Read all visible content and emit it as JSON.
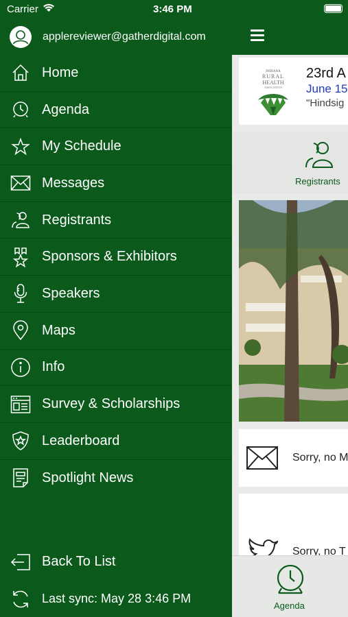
{
  "status": {
    "carrier": "Carrier",
    "time": "3:46 PM"
  },
  "user": {
    "email": "applereviewer@gatherdigital.com"
  },
  "menu": [
    {
      "label": "Home",
      "icon": "home-icon"
    },
    {
      "label": "Agenda",
      "icon": "clock-icon"
    },
    {
      "label": "My Schedule",
      "icon": "star-icon"
    },
    {
      "label": "Messages",
      "icon": "envelope-icon"
    },
    {
      "label": "Registrants",
      "icon": "people-icon"
    },
    {
      "label": "Sponsors & Exhibitors",
      "icon": "ribbon-star-icon"
    },
    {
      "label": "Speakers",
      "icon": "microphone-icon"
    },
    {
      "label": "Maps",
      "icon": "map-pin-icon"
    },
    {
      "label": "Info",
      "icon": "info-icon"
    },
    {
      "label": "Survey &  Scholarships",
      "icon": "survey-icon"
    },
    {
      "label": "Leaderboard",
      "icon": "shield-star-icon"
    },
    {
      "label": "Spotlight News",
      "icon": "news-icon"
    }
  ],
  "bottom_menu": {
    "back_label": "Back To List",
    "sync_label": "Last sync:  May 28 3:46 PM"
  },
  "event": {
    "title": "23rd A",
    "date": "June 15",
    "theme": "\"Hindsig",
    "logo_text": [
      "INDIANA",
      "RURAL",
      "HEALTH",
      "ASSOCIATION"
    ]
  },
  "tiles": {
    "registrants_label": "Registrants"
  },
  "messages_card": {
    "text": "Sorry, no M"
  },
  "twitter_card": {
    "text": "Sorry, no T"
  },
  "tabbar": {
    "agenda_label": "Agenda"
  },
  "colors": {
    "brand_green": "#0b5a1b",
    "date_blue": "#1f3cba"
  }
}
